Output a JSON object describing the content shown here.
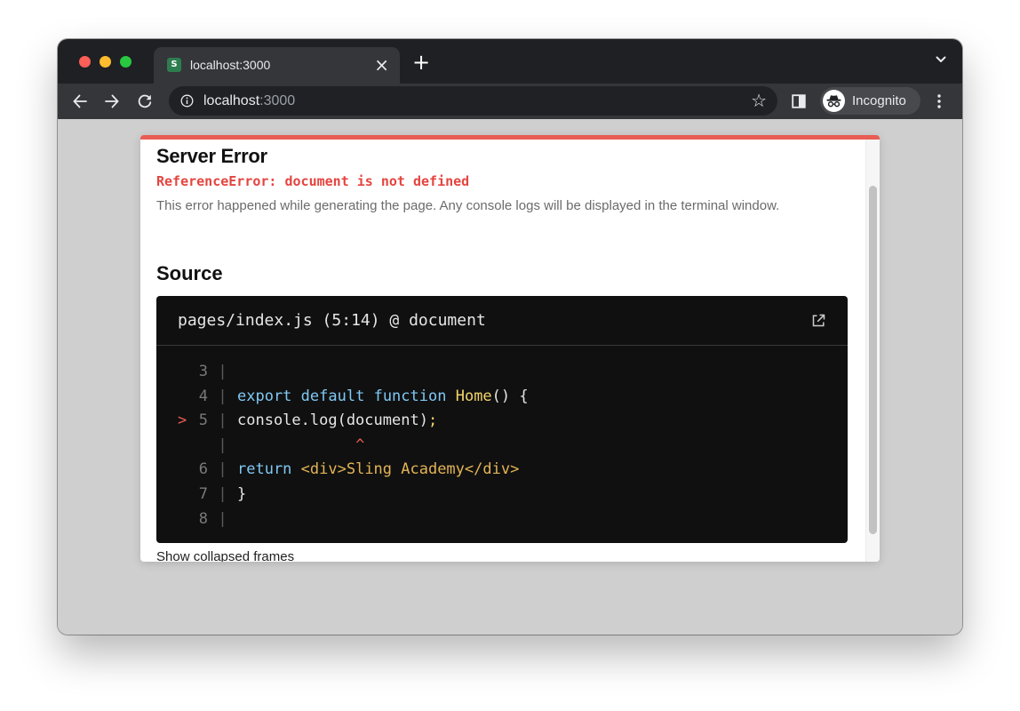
{
  "tab": {
    "favicon_letter": "S",
    "title": "localhost:3000",
    "close": "×"
  },
  "new_tab": "+",
  "omnibox": {
    "url_host": "localhost",
    "url_port": ":3000"
  },
  "star": "☆",
  "profile": {
    "label": "Incognito"
  },
  "error": {
    "title": "Server Error",
    "message": "ReferenceError: document is not defined",
    "description": "This error happened while generating the page. Any console logs will be displayed in the terminal window."
  },
  "source": {
    "title": "Source",
    "file_label": "pages/index.js (5:14) @ document",
    "lines": [
      {
        "number": "3",
        "marker": "",
        "tokens": []
      },
      {
        "number": "4",
        "marker": "",
        "tokens": [
          {
            "t": "export",
            "c": "kw"
          },
          {
            "t": " ",
            "c": ""
          },
          {
            "t": "default",
            "c": "kw"
          },
          {
            "t": " ",
            "c": ""
          },
          {
            "t": "function",
            "c": "kw"
          },
          {
            "t": " ",
            "c": ""
          },
          {
            "t": "Home",
            "c": "fn"
          },
          {
            "t": "() {",
            "c": ""
          }
        ]
      },
      {
        "number": "5",
        "marker": ">",
        "tokens": [
          {
            "t": "console.log(document)",
            "c": ""
          },
          {
            "t": ";",
            "c": "punct-hi"
          }
        ]
      },
      {
        "number": "",
        "marker": "",
        "tokens": [
          {
            "t": "             ",
            "c": ""
          },
          {
            "t": "^",
            "c": "caret"
          }
        ]
      },
      {
        "number": "6",
        "marker": "",
        "tokens": [
          {
            "t": "return",
            "c": "kw"
          },
          {
            "t": " ",
            "c": ""
          },
          {
            "t": "<div>Sling Academy</div>",
            "c": "jsx"
          }
        ]
      },
      {
        "number": "7",
        "marker": "",
        "tokens": [
          {
            "t": "}",
            "c": ""
          }
        ]
      },
      {
        "number": "8",
        "marker": "",
        "tokens": []
      }
    ]
  },
  "show_collapsed": "Show collapsed frames",
  "icons": {
    "back": "arrow-left-icon",
    "forward": "arrow-right-icon",
    "reload": "reload-icon",
    "info": "info-icon",
    "star": "star-icon",
    "side_panel": "side-panel-icon",
    "incognito": "incognito-icon",
    "menu": "kebab-menu-icon",
    "tab_list": "chevron-down-icon",
    "open_in_editor": "external-link-icon"
  },
  "colors": {
    "error_accent": "#e85d55",
    "error_text": "#e4453f",
    "code_bg": "#101010",
    "keyword": "#7fc9f5",
    "function": "#f3d56b",
    "jsx": "#e3b456"
  }
}
